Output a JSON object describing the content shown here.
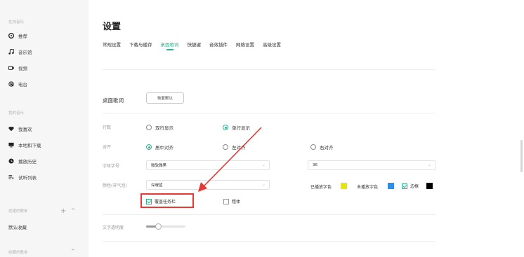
{
  "sidebar": {
    "online_section": "在线音乐",
    "online_items": [
      {
        "label": "推荐",
        "icon": "disc-icon"
      },
      {
        "label": "音乐馆",
        "icon": "music-note-icon"
      },
      {
        "label": "视频",
        "icon": "video-icon"
      },
      {
        "label": "电台",
        "icon": "radio-icon"
      }
    ],
    "my_section": "我的音乐",
    "my_items": [
      {
        "label": "我喜欢",
        "icon": "heart-icon"
      },
      {
        "label": "本地和下载",
        "icon": "computer-icon"
      },
      {
        "label": "播放历史",
        "icon": "clock-icon"
      },
      {
        "label": "试听列表",
        "icon": "playlist-icon"
      }
    ],
    "created_section": "创建的歌单",
    "default_fav": "默认收藏",
    "collected_section": "收藏的歌单"
  },
  "main": {
    "title": "设置",
    "tabs": [
      {
        "label": "常规设置"
      },
      {
        "label": "下载与缓存"
      },
      {
        "label": "桌面歌词"
      },
      {
        "label": "快捷键"
      },
      {
        "label": "音效插件"
      },
      {
        "label": "网络设置"
      },
      {
        "label": "高级设置"
      }
    ],
    "active_tab": "桌面歌词"
  },
  "lyrics": {
    "section_title": "桌面歌词",
    "restore_label": "恢复默认",
    "rows_label": "行数",
    "rows_options": [
      "双行显示",
      "单行显示"
    ],
    "rows_selected": "单行显示",
    "align_label": "对齐",
    "align_options": [
      "居中对齐",
      "左对齐",
      "右对齐"
    ],
    "align_selected": "居中对齐",
    "font_label": "字体字号",
    "font_value": "微软雅黑",
    "size_value": "36",
    "color_label": "颜色(非气泡)",
    "color_value": "深邃蓝",
    "played_label": "已播放字色",
    "unplayed_label": "未播放字色",
    "border_label": "边框",
    "taskbar_label": "覆盖任务栏",
    "bold_label": "粗体",
    "opacity_label": "文字透明度",
    "opacity_value": 0.3
  },
  "colors": {
    "accent": "#26b58e",
    "played": "#e6e600",
    "unplayed": "#2e8fe8",
    "border": "#000000",
    "annotation": "#e53935"
  }
}
